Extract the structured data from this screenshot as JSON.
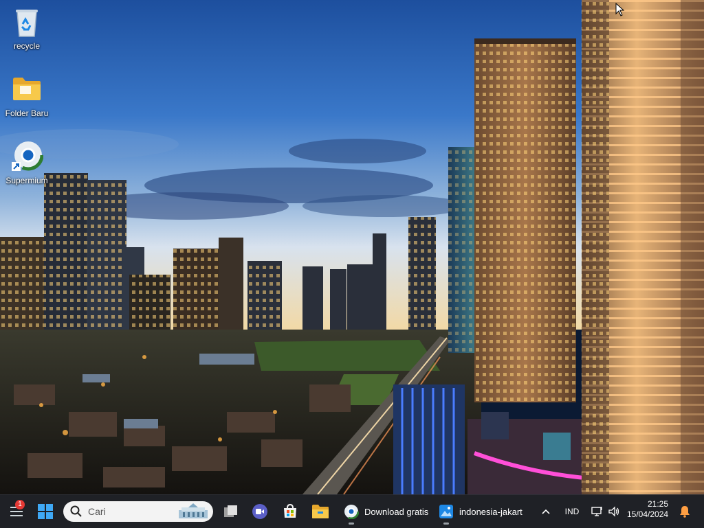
{
  "desktop": {
    "icons": [
      {
        "label": "recycle",
        "icon": "recycle-bin-icon"
      },
      {
        "label": "Folder Baru",
        "icon": "folder-icon"
      },
      {
        "label": "Supermium",
        "icon": "supermium-browser-icon"
      }
    ]
  },
  "taskbar": {
    "notification_count": "1",
    "search_placeholder": "Cari",
    "apps": [
      {
        "name": "start",
        "icon": "windows-start-icon"
      },
      {
        "name": "task-view",
        "icon": "task-view-icon"
      },
      {
        "name": "teams-meet",
        "icon": "video-call-icon"
      },
      {
        "name": "microsoft-store",
        "icon": "store-icon"
      },
      {
        "name": "file-explorer",
        "icon": "folder-icon"
      },
      {
        "label": "Download gratis",
        "icon": "supermium-browser-icon"
      },
      {
        "label": "indonesia-jakart",
        "icon": "photos-icon"
      }
    ],
    "tray": {
      "language": "IND",
      "time": "21:25",
      "date": "15/04/2024"
    }
  },
  "colors": {
    "taskbar_bg": "#1f2126",
    "accent": "#0078d4",
    "notification_red": "#e53935"
  }
}
